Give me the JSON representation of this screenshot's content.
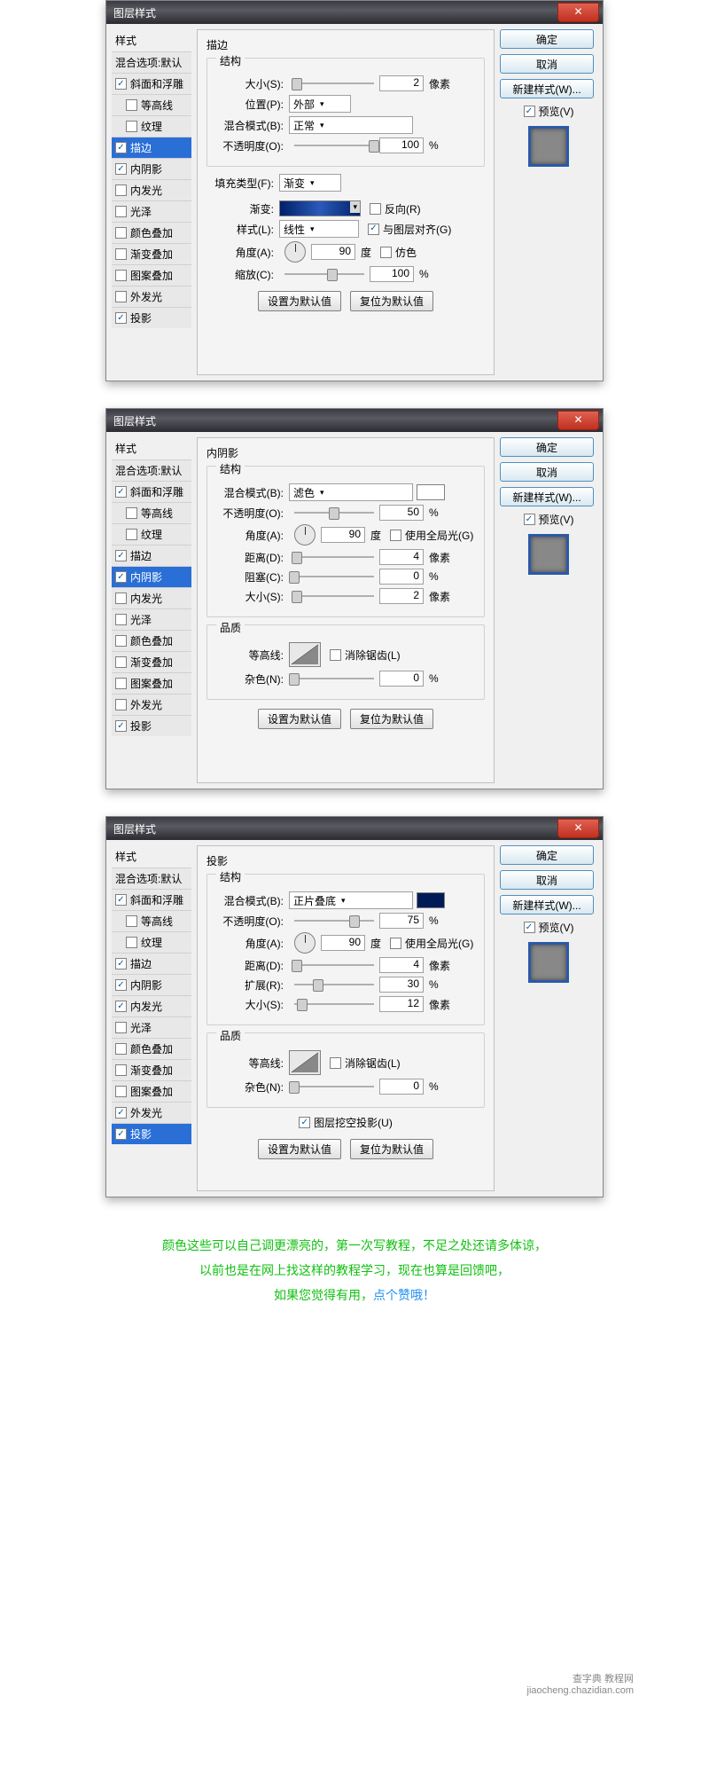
{
  "dlg": {
    "title": "图层样式",
    "styles_header": "样式",
    "blend_default": "混合选项:默认",
    "items": {
      "bevel": "斜面和浮雕",
      "contour": "等高线",
      "texture": "纹理",
      "stroke": "描边",
      "inner_shadow": "内阴影",
      "inner_glow": "内发光",
      "satin": "光泽",
      "color_overlay": "颜色叠加",
      "grad_overlay": "渐变叠加",
      "pat_overlay": "图案叠加",
      "outer_glow": "外发光",
      "drop_shadow": "投影"
    },
    "right": {
      "ok": "确定",
      "cancel": "取消",
      "newstyle": "新建样式(W)...",
      "preview": "预览(V)"
    },
    "btns": {
      "default": "设置为默认值",
      "reset": "复位为默认值"
    }
  },
  "d1": {
    "title": "描边",
    "struct": "结构",
    "size_l": "大小(S):",
    "size": "2",
    "px": "像素",
    "pos_l": "位置(P):",
    "pos": "外部",
    "blend_l": "混合模式(B):",
    "blend": "正常",
    "opac_l": "不透明度(O):",
    "opac": "100",
    "pct": "%",
    "fill_l": "填充类型(F):",
    "fill": "渐变",
    "grad_l": "渐变:",
    "reverse": "反向(R)",
    "style_l": "样式(L):",
    "style": "线性",
    "align": "与图层对齐(G)",
    "angle_l": "角度(A):",
    "angle": "90",
    "deg": "度",
    "dither": "仿色",
    "scale_l": "缩放(C):",
    "scale": "100"
  },
  "d2": {
    "title": "内阴影",
    "struct": "结构",
    "blend_l": "混合模式(B):",
    "blend": "滤色",
    "opac_l": "不透明度(O):",
    "opac": "50",
    "pct": "%",
    "angle_l": "角度(A):",
    "angle": "90",
    "deg": "度",
    "global": "使用全局光(G)",
    "dist_l": "距离(D):",
    "dist": "4",
    "px": "像素",
    "choke_l": "阻塞(C):",
    "choke": "0",
    "size_l": "大小(S):",
    "size": "2",
    "quality": "品质",
    "contour_l": "等高线:",
    "antialias": "消除锯齿(L)",
    "noise_l": "杂色(N):",
    "noise": "0"
  },
  "d3": {
    "title": "投影",
    "struct": "结构",
    "blend_l": "混合模式(B):",
    "blend": "正片叠底",
    "opac_l": "不透明度(O):",
    "opac": "75",
    "pct": "%",
    "angle_l": "角度(A):",
    "angle": "90",
    "deg": "度",
    "global": "使用全局光(G)",
    "dist_l": "距离(D):",
    "dist": "4",
    "px": "像素",
    "spread_l": "扩展(R):",
    "spread": "30",
    "size_l": "大小(S):",
    "size": "12",
    "quality": "品质",
    "contour_l": "等高线:",
    "antialias": "消除锯齿(L)",
    "noise_l": "杂色(N):",
    "noise": "0",
    "knockout": "图层挖空投影(U)"
  },
  "footer": {
    "l1": "颜色这些可以自己调更漂亮的，第一次写教程，不足之处还请多体谅，",
    "l2": "以前也是在网上找这样的教程学习，现在也算是回馈吧，",
    "l3a": "如果您觉得有用，",
    "l3b": "点个赞哦！"
  },
  "watermark": {
    "l1": "查字典 教程网",
    "l2": "jiaocheng.chazidian.com"
  }
}
